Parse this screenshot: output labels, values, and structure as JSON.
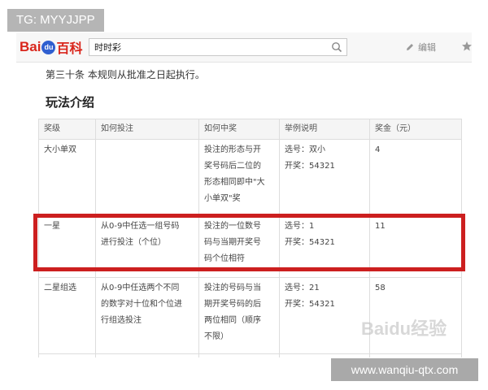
{
  "overlay_tag": "TG: MYYJJPP",
  "header": {
    "logo_bai": "Bai",
    "logo_du": "du",
    "logo_baike": "百科",
    "search_value": "时时彩",
    "edit_label": "编辑"
  },
  "article_line": "第三十条 本规则从批准之日起执行。",
  "section_title": "玩法介绍",
  "table": {
    "headers": [
      "奖级",
      "如何投注",
      "如何中奖",
      "举例说明",
      "奖金（元）"
    ],
    "rows": [
      {
        "level": "大小单双",
        "how_bet": "",
        "how_win": [
          "投注的形态与开",
          "奖号码后二位的",
          "形态相同即中\"大",
          "小单双\"奖"
        ],
        "example": [
          "选号：双小",
          "开奖：54321"
        ],
        "prize": "4"
      },
      {
        "level": "一星",
        "how_bet": [
          "从0-9中任选一组号码",
          "进行投注（个位）"
        ],
        "how_win": [
          "投注的一位数号",
          "码与当期开奖号",
          "码个位相符"
        ],
        "example": [
          "选号：1",
          "开奖：54321"
        ],
        "prize": "11"
      },
      {
        "level": "二星组选",
        "how_bet": [
          "从0-9中任选两个不同",
          "的数字对十位和个位进",
          "行组选投注"
        ],
        "how_win": [
          "投注的号码与当",
          "期开奖号码的后",
          "两位相同（顺序",
          "不限）"
        ],
        "example": [
          "选号：21",
          "开奖：54321"
        ],
        "prize": "58"
      }
    ]
  },
  "watermark": "Baidu经验",
  "footer_url": "www.wanqiu-qtx.com",
  "colors": {
    "highlight_border": "#cc1f1f",
    "baidu_red": "#d9261c",
    "baidu_blue": "#2f5fd0"
  }
}
